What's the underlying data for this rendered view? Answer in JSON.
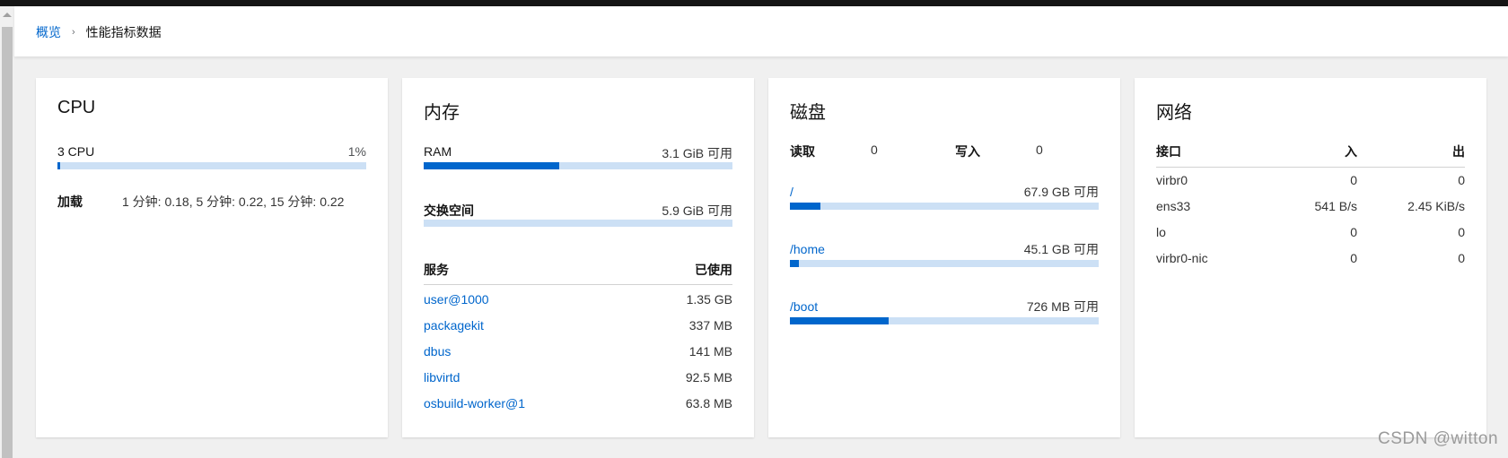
{
  "breadcrumb": {
    "parent": "概览",
    "separator": "›",
    "current": "性能指标数据"
  },
  "cpu": {
    "title": "CPU",
    "count_label": "3 CPU",
    "usage_text": "1%",
    "usage_percent": 1,
    "load_label": "加载",
    "load_value": "1 分钟: 0.18, 5 分钟: 0.22, 15 分钟: 0.22"
  },
  "memory": {
    "title": "内存",
    "ram_label": "RAM",
    "ram_available": "3.1 GiB 可用",
    "ram_used_percent": 44,
    "swap_label": "交换空间",
    "swap_available": "5.9 GiB 可用",
    "swap_used_percent": 0,
    "services_header": "服务",
    "used_header": "已使用",
    "services": [
      {
        "name": "user@1000",
        "used": "1.35 GB"
      },
      {
        "name": "packagekit",
        "used": "337 MB"
      },
      {
        "name": "dbus",
        "used": "141 MB"
      },
      {
        "name": "libvirtd",
        "used": "92.5 MB"
      },
      {
        "name": "osbuild-worker@1",
        "used": "63.8 MB"
      }
    ]
  },
  "disk": {
    "title": "磁盘",
    "read_label": "读取",
    "read_value": "0",
    "write_label": "写入",
    "write_value": "0",
    "mounts": [
      {
        "path": "/",
        "available": "67.9 GB 可用",
        "used_percent": 10
      },
      {
        "path": "/home",
        "available": "45.1 GB 可用",
        "used_percent": 3
      },
      {
        "path": "/boot",
        "available": "726 MB 可用",
        "used_percent": 32
      }
    ]
  },
  "network": {
    "title": "网络",
    "col_interface": "接口",
    "col_in": "入",
    "col_out": "出",
    "interfaces": [
      {
        "name": "virbr0",
        "in": "0",
        "out": "0"
      },
      {
        "name": "ens33",
        "in": "541 B/s",
        "out": "2.45 KiB/s"
      },
      {
        "name": "lo",
        "in": "0",
        "out": "0"
      },
      {
        "name": "virbr0-nic",
        "in": "0",
        "out": "0"
      }
    ]
  },
  "colors": {
    "accent": "#0066cc",
    "bar_track": "#cce0f5"
  },
  "watermark": "CSDN @witton"
}
